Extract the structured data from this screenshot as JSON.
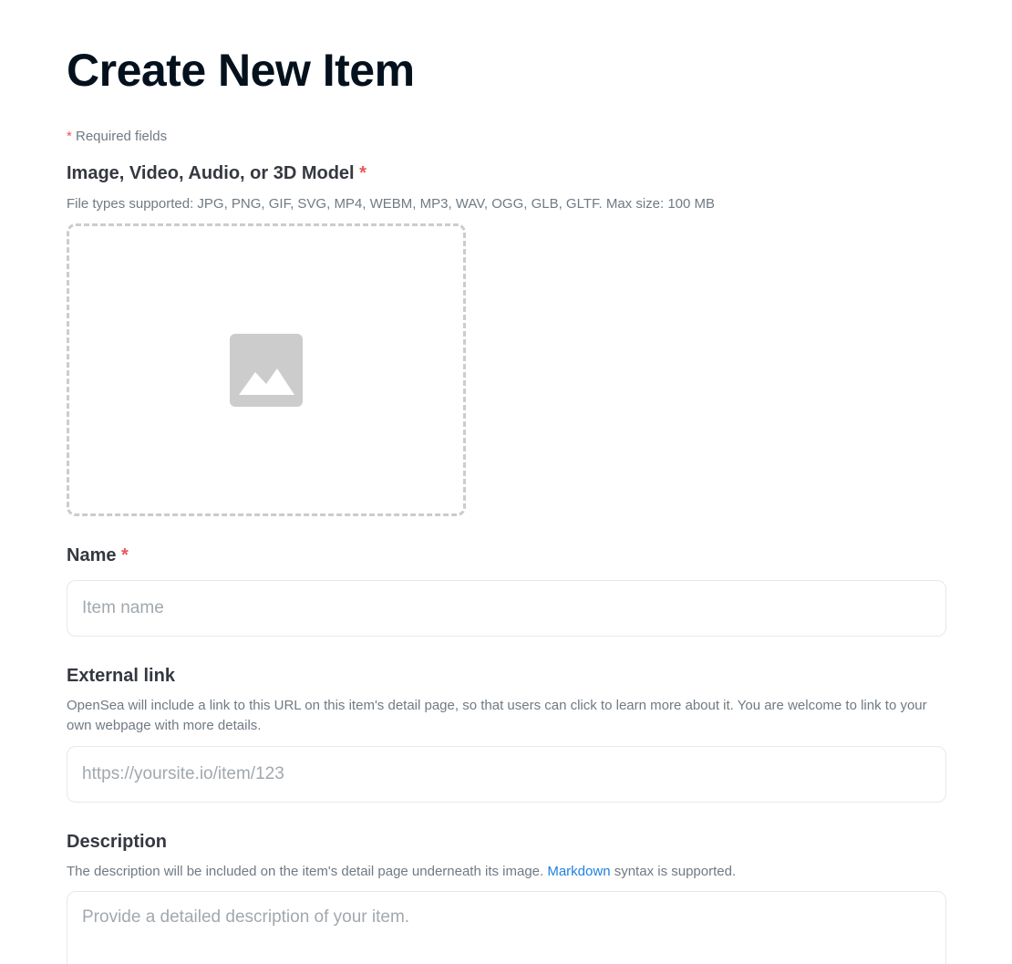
{
  "page": {
    "title": "Create New Item",
    "required_note_star": "*",
    "required_note_text": " Required fields"
  },
  "media": {
    "label": "Image, Video, Audio, or 3D Model",
    "required_star": "*",
    "help": "File types supported: JPG, PNG, GIF, SVG, MP4, WEBM, MP3, WAV, OGG, GLB, GLTF. Max size: 100 MB",
    "icon": "image-placeholder-icon"
  },
  "name_field": {
    "label": "Name",
    "required_star": "*",
    "placeholder": "Item name",
    "value": ""
  },
  "external_link": {
    "label": "External link",
    "help": "OpenSea will include a link to this URL on this item's detail page, so that users can click to learn more about it. You are welcome to link to your own webpage with more details.",
    "placeholder": "https://yoursite.io/item/123",
    "value": ""
  },
  "description": {
    "label": "Description",
    "help_before": "The description will be included on the item's detail page underneath its image. ",
    "help_link": "Markdown",
    "help_after": " syntax is supported.",
    "placeholder": "Provide a detailed description of your item.",
    "value": ""
  },
  "colors": {
    "accent_link": "#2081e2",
    "required_star": "#eb5757",
    "placeholder_icon": "#cccccc"
  }
}
